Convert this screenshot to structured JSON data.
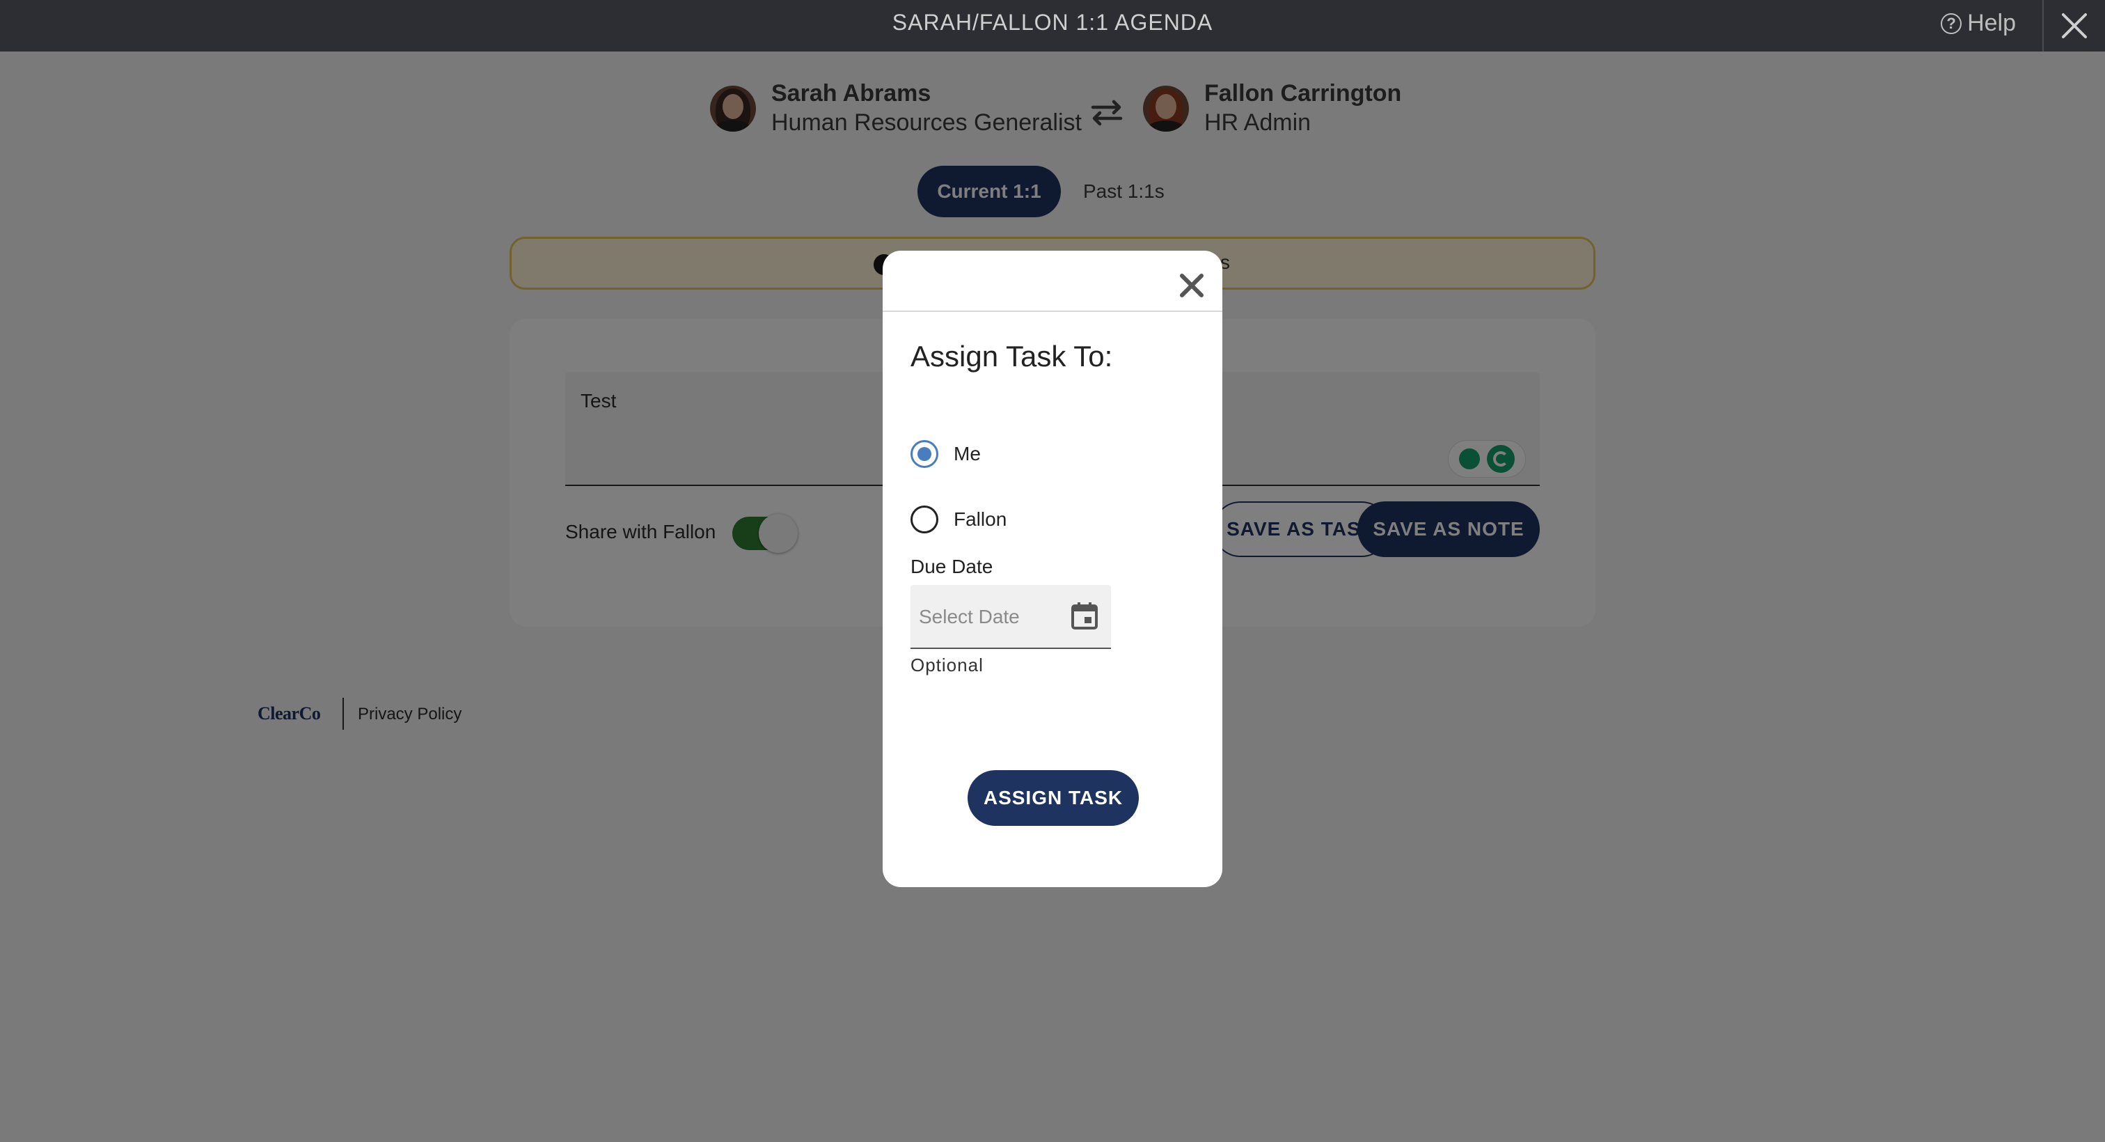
{
  "topbar": {
    "title": "SARAH/FALLON 1:1 AGENDA",
    "help_label": "Help",
    "help_icon": "question-circle-icon",
    "close_icon": "close-icon"
  },
  "participants": {
    "left": {
      "name": "Sarah Abrams",
      "role": "Human Resources Generalist"
    },
    "right": {
      "name": "Fallon Carrington",
      "role": "HR Admin"
    },
    "swap_icon": "swap-arrows-icon"
  },
  "tabs": {
    "current": "Current 1:1",
    "past": "Past 1:1s"
  },
  "banner": {
    "visible_tail": "s"
  },
  "note": {
    "text": "Test",
    "share_label": "Share with Fallon",
    "share_enabled": true,
    "save_task_label": "SAVE AS TASK",
    "save_note_label": "SAVE AS NOTE"
  },
  "footer": {
    "logo": "ClearCo",
    "privacy_link": "Privacy Policy"
  },
  "modal": {
    "title": "Assign Task To:",
    "options": [
      {
        "label": "Me",
        "selected": true
      },
      {
        "label": "Fallon",
        "selected": false
      }
    ],
    "due_date_label": "Due Date",
    "date_placeholder": "Select Date",
    "helper_text": "Optional",
    "submit_label": "ASSIGN TASK"
  },
  "colors": {
    "primary": "#1f3360",
    "radio_selected": "#4a7dc0",
    "toggle_on": "#2e7d32",
    "banner_border": "#e7c25c"
  }
}
